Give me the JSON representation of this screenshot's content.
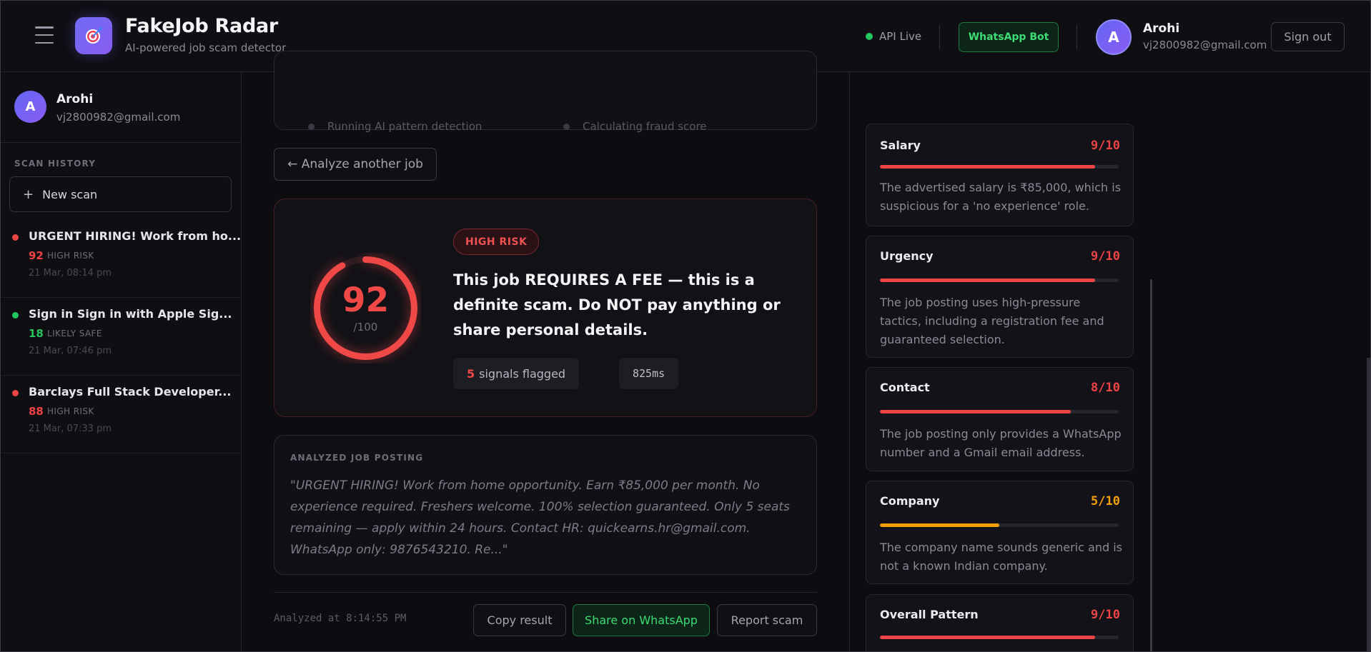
{
  "header": {
    "brand_title": "FakeJob Radar",
    "brand_subtitle": "AI-powered job scam detector",
    "api_status": "API Live",
    "whatsapp_bot_label": "WhatsApp Bot",
    "user_initial": "A",
    "user_name": "Arohi",
    "user_email": "vj2800982@gmail.com",
    "signout_label": "Sign out"
  },
  "sidebar": {
    "user_initial": "A",
    "user_name": "Arohi",
    "user_email": "vj2800982@gmail.com",
    "history_heading": "SCAN HISTORY",
    "new_scan_label": "New scan",
    "history": [
      {
        "title": "URGENT HIRING! Work from ho...",
        "score": "92",
        "level": "HIGH RISK",
        "date": "21 Mar, 08:14 pm",
        "status_color": "#ef4444"
      },
      {
        "title": "Sign in Sign in with Apple Sig...",
        "score": "18",
        "level": "LIKELY SAFE",
        "date": "21 Mar, 07:46 pm",
        "status_color": "#22c55e"
      },
      {
        "title": "Barclays Full Stack Developer...",
        "score": "88",
        "level": "HIGH RISK",
        "date": "21 Mar, 07:33 pm",
        "status_color": "#ef4444"
      }
    ]
  },
  "progress": {
    "step1": "Running AI pattern detection",
    "step2": "Calculating fraud score"
  },
  "main": {
    "back_label": "← Analyze another job",
    "score": "92",
    "score_fraction": 0.92,
    "score_max": "/100",
    "risk_label": "HIGH RISK",
    "verdict": "This job REQUIRES A FEE — this is a definite scam. Do NOT pay anything or share personal details.",
    "signals_count": "5",
    "signals_label": "signals flagged",
    "latency": "825ms",
    "posting_label": "ANALYZED JOB POSTING",
    "posting_text": "\"URGENT HIRING! Work from home opportunity. Earn ₹85,000 per month. No experience required. Freshers welcome. 100% selection guaranteed. Only 5 seats remaining — apply within 24 hours. Contact HR: quickearns.hr@gmail.com. WhatsApp only: 9876543210. Re...\"",
    "analyzed_at": "Analyzed at 8:14:55 PM",
    "copy_label": "Copy result",
    "share_label": "Share on WhatsApp",
    "report_label": "Report scam"
  },
  "signals": [
    {
      "name": "Salary",
      "score": "9/10",
      "fraction": 0.9,
      "color": "#ef4444",
      "text": "The advertised salary is ₹85,000, which is suspicious for a 'no experience' role."
    },
    {
      "name": "Urgency",
      "score": "9/10",
      "fraction": 0.9,
      "color": "#ef4444",
      "text": "The job posting uses high-pressure tactics, including a registration fee and guaranteed selection."
    },
    {
      "name": "Contact",
      "score": "8/10",
      "fraction": 0.8,
      "color": "#ef4444",
      "text": "The job posting only provides a WhatsApp number and a Gmail email address."
    },
    {
      "name": "Company",
      "score": "5/10",
      "fraction": 0.5,
      "color": "#f59e0b",
      "text": "The company name sounds generic and is not a known Indian company."
    },
    {
      "name": "Overall Pattern",
      "score": "9/10",
      "fraction": 0.9,
      "color": "#ef4444",
      "text": ""
    }
  ]
}
